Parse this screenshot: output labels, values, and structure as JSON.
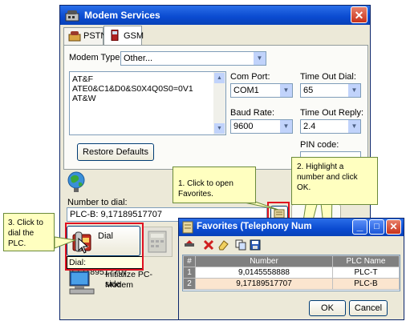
{
  "modem_window": {
    "title": "Modem Services",
    "tabs": [
      {
        "label": "PSTN"
      },
      {
        "label": "GSM"
      }
    ],
    "modem_type": {
      "label": "Modem Type:",
      "value": "Other..."
    },
    "init_strings": [
      "AT&F",
      "ATE0&C1&D0&S0X4Q0S0=0V1",
      "AT&W"
    ],
    "com_port": {
      "label": "Com Port:",
      "value": "COM1"
    },
    "timeout_dial": {
      "label": "Time Out Dial:",
      "value": "65"
    },
    "baud_rate": {
      "label": "Baud Rate:",
      "value": "9600"
    },
    "timeout_reply": {
      "label": "Time Out Reply:",
      "value": "2.4"
    },
    "pin_code": {
      "label": "PIN code:",
      "value": ""
    },
    "restore_defaults": "Restore Defaults",
    "number_to_dial": {
      "label": "Number to dial:",
      "value": "PLC-B: 9,17189517707"
    },
    "dial_button": "Dial",
    "dial_status": "Dial: 9,17189517707",
    "initialize_line1": "Initialize PC-side",
    "initialize_line2": "Modem"
  },
  "favorites_window": {
    "title": "Favorites (Telephony Num",
    "columns": [
      "#",
      "Number",
      "PLC Name"
    ],
    "rows": [
      {
        "index": "1",
        "number": "9,0145558888",
        "plc": "PLC-T"
      },
      {
        "index": "2",
        "number": "9,17189517707",
        "plc": "PLC-B"
      }
    ],
    "ok": "OK",
    "cancel": "Cancel"
  },
  "callouts": {
    "c1_line1": "1. Click to open",
    "c1_line2": "Favorites.",
    "c2_line1": "2. Highlight  a",
    "c2_line2": "number and click",
    "c2_line3": "OK.",
    "c3_line1": "3. Click to",
    "c3_line2": "dial the",
    "c3_line3": "PLC."
  },
  "colors": {
    "titlebar": "#0a4ad0",
    "callout_bg": "#ffffc0",
    "highlight": "#e01020",
    "row_bg": "#fbe5cf"
  }
}
